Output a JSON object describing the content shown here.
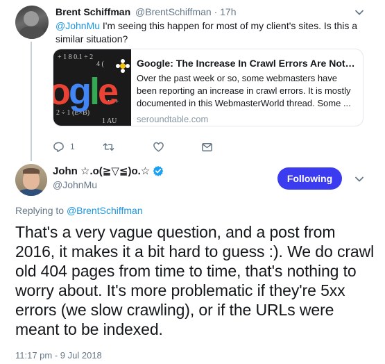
{
  "reply_tweet": {
    "author_name": "Brent Schiffman",
    "author_handle": "@BrentSchiffman",
    "time": "· 17h",
    "mention": "@JohnMu",
    "text": " I'm seeing this happen for most of my client's sites. Is this a similar situation?",
    "card": {
      "title": "Google: The Increase In Crawl Errors Are Nothi...",
      "description": "Over the past week or so, some webmasters have been reporting an increase in crawl errors. It is mostly documented in this WebmasterWorld thread. Some ...",
      "domain": "seroundtable.com",
      "image_logo_text": "ogle"
    },
    "actions": {
      "reply_count": "1",
      "retweet_count": "",
      "like_count": ""
    }
  },
  "main_tweet": {
    "author_name": "John ☆.o(≧▽≦)o.☆",
    "author_handle": "@JohnMu",
    "follow_label": "Following",
    "replying_prefix": "Replying to ",
    "replying_to": "@BrentSchiffman",
    "text": "That's a very vague question, and a post from 2016, it makes it a bit hard to guess :). We do crawl old 404 pages from time to time, that's nothing to worry about. It's more problematic if they're 5xx errors (we slow crawling), or if the URLs were meant to be indexed.",
    "timestamp": "11:17 pm - 9 Jul 2018"
  },
  "icons": [
    "chevron-down-icon",
    "reply-icon",
    "retweet-icon",
    "like-icon",
    "direct-message-icon",
    "verified-badge-icon"
  ],
  "colors": {
    "link": "#1b95e0",
    "follow_button": "#3b3bf0",
    "secondary_text": "#657786",
    "thread_line": "#c4cfd6",
    "verified": "#1da1f2"
  }
}
